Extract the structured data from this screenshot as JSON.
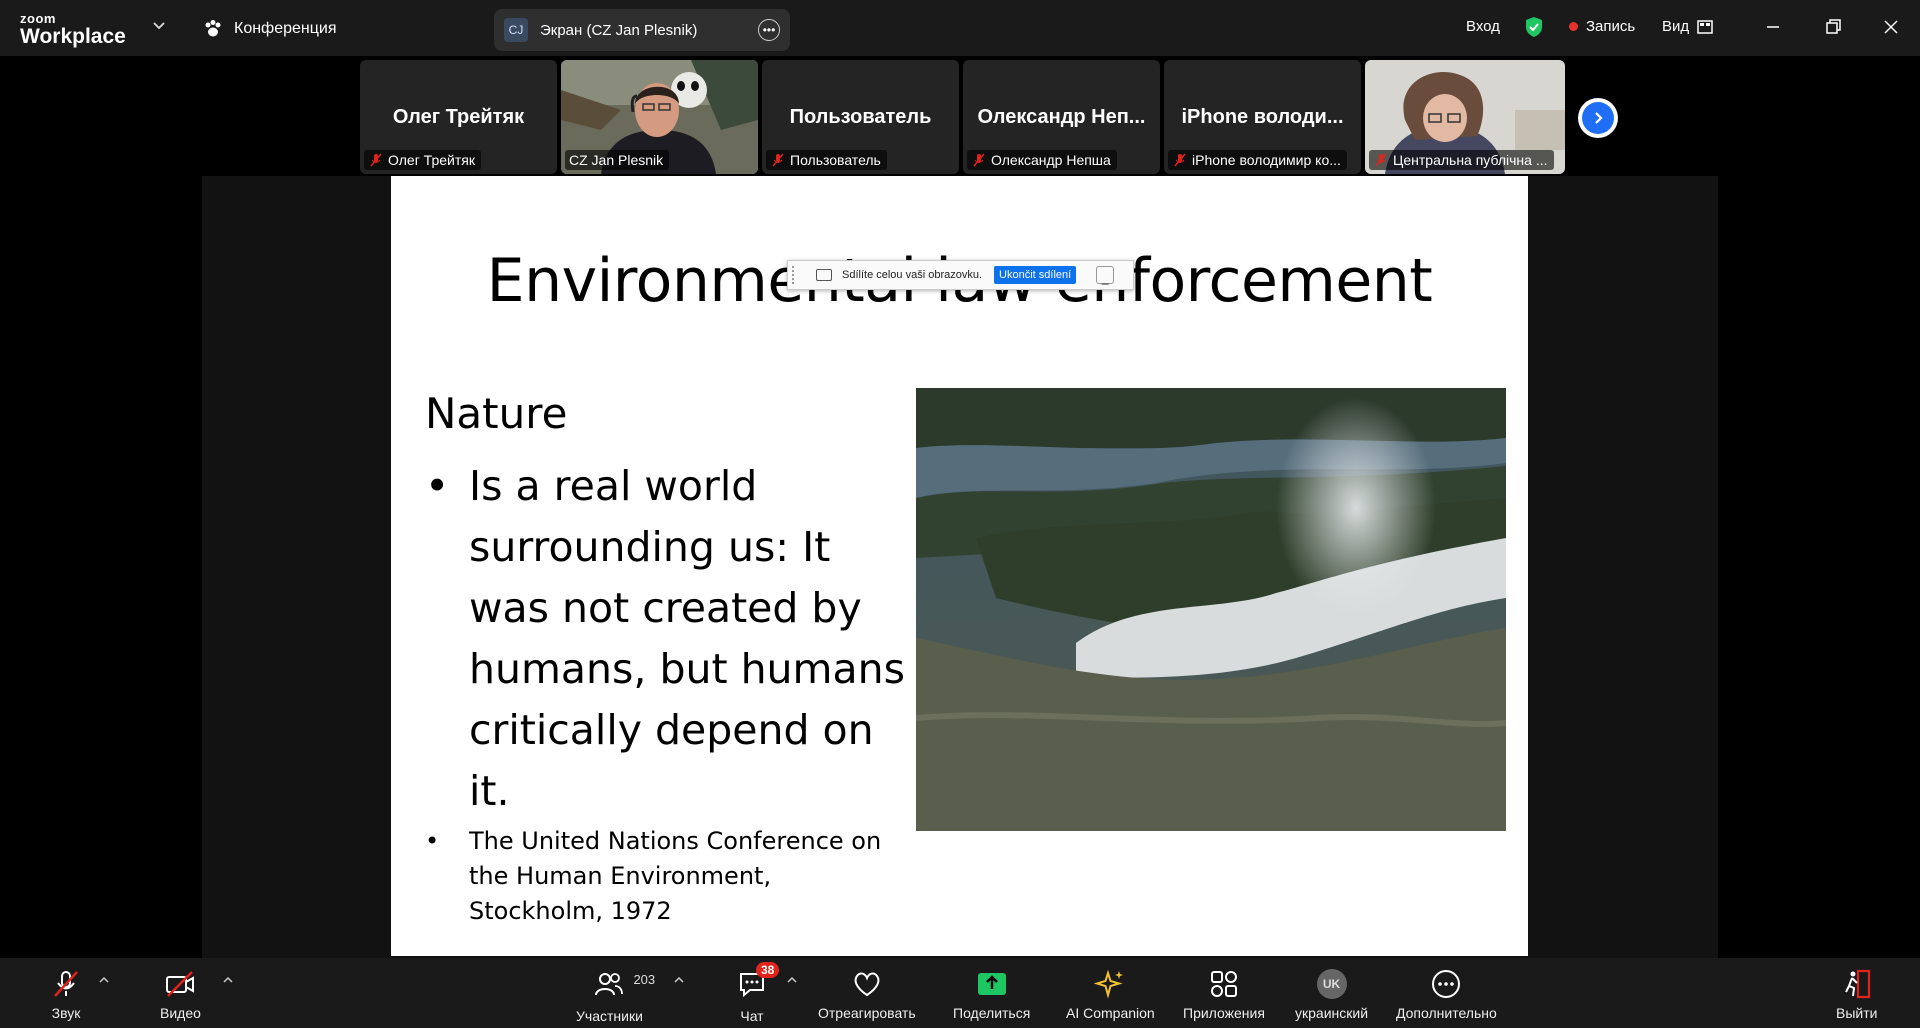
{
  "app": {
    "logo_top": "zoom",
    "logo_bottom": "Workplace"
  },
  "header": {
    "meeting_label": "Конференция",
    "screen_initials": "CJ",
    "screen_label": "Экран (CZ Jan Plesnik)",
    "login": "Вход",
    "record": "Запись",
    "view": "Вид"
  },
  "participants": [
    {
      "name": "Олег Трейтяк",
      "display": "Олег Трейтяк"
    },
    {
      "name": "CZ Jan Plesnik",
      "display": ""
    },
    {
      "name": "Пользователь",
      "display": "Пользователь"
    },
    {
      "name": "Олександр Непша",
      "display": "Олександр Неп..."
    },
    {
      "name": "iPhone володимир ко...",
      "display": "iPhone володи..."
    },
    {
      "name": "Центральна публічна ...",
      "display": ""
    }
  ],
  "slide": {
    "title": "Environmental law enforcement",
    "heading": "Nature",
    "bullet_main": "Is a real world surrounding us: It was not created by humans, but humans critically depend on it.",
    "bullet_secondary": "The United Nations Conference on the Human Environment, Stockholm, 1972"
  },
  "share_bar": {
    "text": "Sdílíte celou vaši obrazovku.",
    "stop_label": "Ukončit sdílení"
  },
  "toolbar": {
    "audio": "Звук",
    "video": "Видео",
    "participants": "Участники",
    "participants_count": "203",
    "chat": "Чат",
    "chat_badge": "38",
    "react": "Отреагировать",
    "share": "Поделиться",
    "ai": "AI Companion",
    "apps": "Приложения",
    "lang_code": "UK",
    "lang": "украинский",
    "more": "Дополнительно",
    "leave": "Выйти"
  },
  "colors": {
    "accent": "#0e72ed",
    "speaker_outline": "#4ad88a",
    "share_green": "#1ec761",
    "alert_red": "#e0241b"
  }
}
